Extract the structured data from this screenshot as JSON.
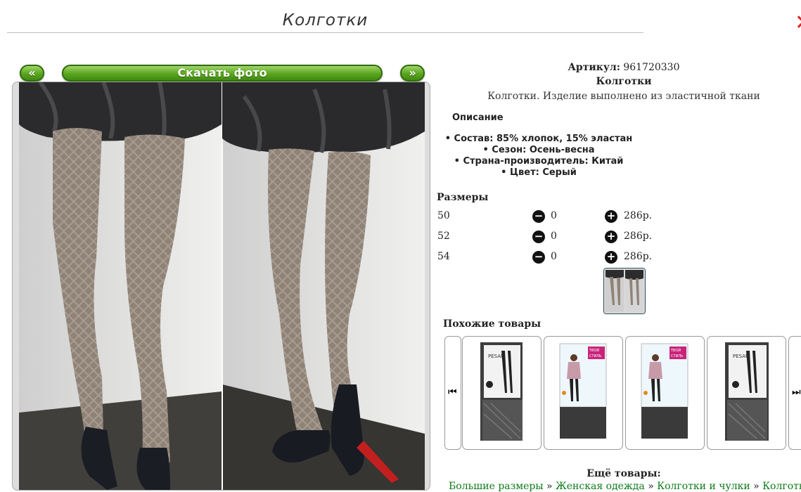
{
  "header": {
    "title": "Колготки",
    "close_symbol": "✕"
  },
  "gallery": {
    "prev_label": "«",
    "download_label": "Скачать фото",
    "next_label": "»"
  },
  "product": {
    "article_label": "Артикул:",
    "article_value": "961720330",
    "name": "Колготки",
    "short_desc": "Колготки. Изделие выполнено из эластичной ткани",
    "description_heading": "Описание",
    "specs": [
      "• Состав: 85% хлопок, 15% эластан",
      "• Сезон: Осень-весна",
      "• Страна-производитель: Китай",
      "• Цвет: Серый"
    ]
  },
  "sizes": {
    "heading": "Размеры",
    "rows": [
      {
        "size": "50",
        "qty": "0",
        "price": "286р."
      },
      {
        "size": "52",
        "qty": "0",
        "price": "286р."
      },
      {
        "size": "54",
        "qty": "0",
        "price": "286р."
      }
    ]
  },
  "similar": {
    "heading": "Похожие товары",
    "cards": [
      {
        "icon": "pesail-tights-package"
      },
      {
        "icon": "tvoy-stil-tights-package"
      },
      {
        "icon": "tvoy-stil-tights-package"
      },
      {
        "icon": "pesail-tights-package"
      }
    ]
  },
  "more": {
    "heading": "Ещё товары:",
    "breadcrumb": [
      "Большие размеры",
      "Женская одежда",
      "Колготки и чулки",
      "Колготки"
    ],
    "separator": "»"
  },
  "colors": {
    "button_green": "#5aa51f",
    "link_green": "#0c7a18",
    "close_red": "#e02020"
  }
}
